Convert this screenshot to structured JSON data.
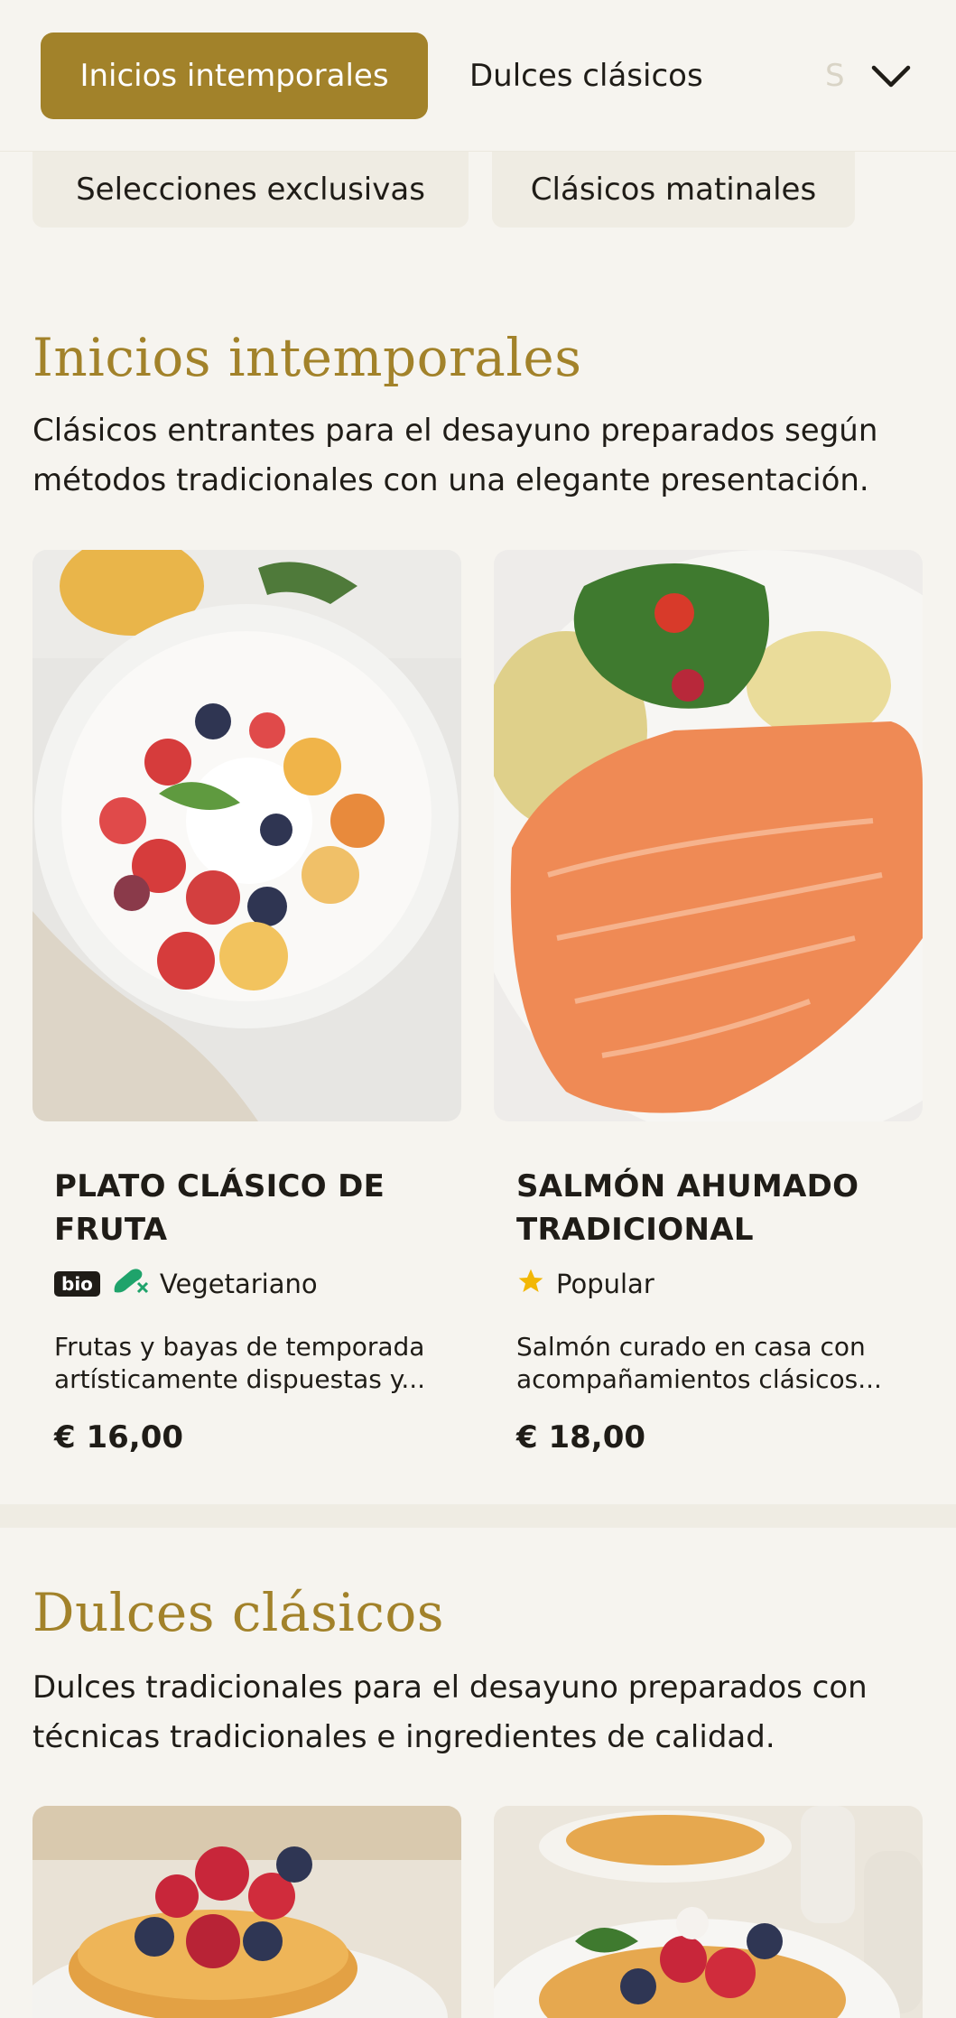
{
  "nav": {
    "tabs": [
      {
        "label": "Inicios intemporales",
        "active": true
      },
      {
        "label": "Dulces clásicos",
        "active": false
      },
      {
        "label": "S",
        "active": false
      }
    ],
    "chips": [
      "Selecciones exclusivas",
      "Clásicos matinales"
    ],
    "expand_icon": "chevron-down-icon"
  },
  "sections": [
    {
      "title": "Inicios intemporales",
      "description": "Clásicos entrantes para el desayuno preparados según métodos tradicionales con una elegante presentación.",
      "items": [
        {
          "title": "PLATO CLÁSICO DE FRUTA",
          "badge": "bio",
          "tag_icon": "no-meat-icon",
          "tag": "Vegetariano",
          "description": "Frutas y bayas de temporada artísticamente dispuestas y...",
          "price": "€ 16,00",
          "image": "fruit-bowl-photo"
        },
        {
          "title": "SALMÓN AHUMADO TRADICIONAL",
          "tag_icon": "star-icon",
          "tag": "Popular",
          "description": "Salmón curado en casa con acompañamientos clásicos...",
          "price": "€ 18,00",
          "image": "salmon-plate-photo"
        }
      ]
    },
    {
      "title": "Dulces clásicos",
      "description": "Dulces tradicionales para el desayuno preparados con técnicas tradicionales e ingredientes de calidad.",
      "items": [
        {
          "image": "pancakes-photo"
        },
        {
          "image": "waffles-photo"
        }
      ]
    }
  ],
  "colors": {
    "accent": "#a2822a",
    "background": "#f6f4ef",
    "chip": "#efece3",
    "star": "#f2b705",
    "veg": "#1fa36b"
  }
}
